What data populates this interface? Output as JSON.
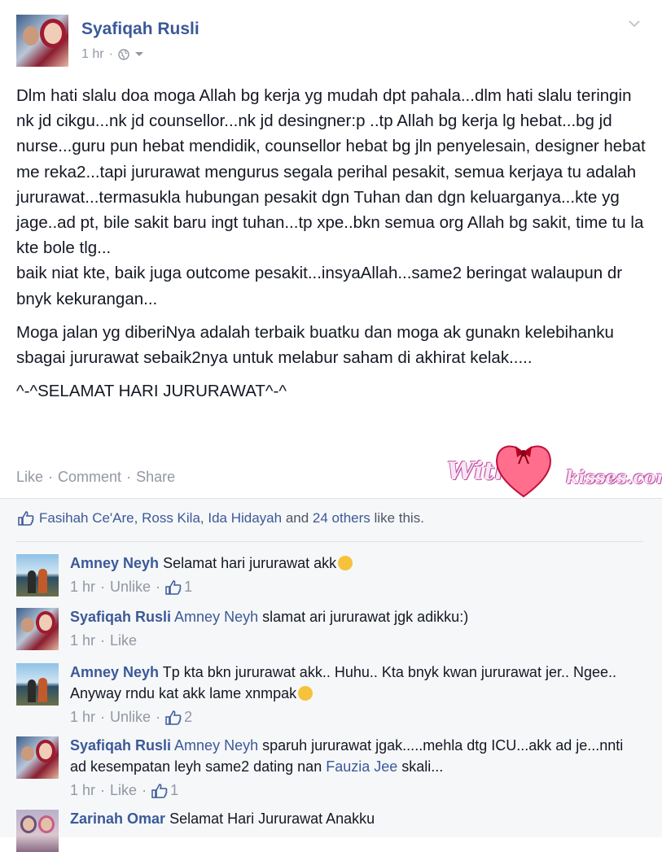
{
  "post": {
    "author": "Syafiqah Rusli",
    "time": "1 hr",
    "paragraphs": [
      "Dlm hati slalu doa moga Allah bg kerja yg mudah dpt pahala...dlm hati slalu teringin nk jd cikgu...nk jd counsellor...nk jd desingner:p ..tp Allah bg kerja lg hebat...bg jd nurse...guru pun hebat mendidik, counsellor hebat bg jln penyelesain, designer hebat me reka2...tapi jururawat mengurus segala perihal pesakit, semua kerjaya tu adalah jururawat...termasukla hubungan pesakit dgn Tuhan dan dgn keluarganya...kte yg jage..ad pt, bile sakit baru ingt tuhan...tp xpe..bkn semua org Allah bg sakit, time tu la kte bole tlg...\nbaik niat kte, baik juga outcome pesakit...insyaAllah...same2 beringat walaupun dr bnyk kekurangan...",
      "Moga jalan yg diberiNya adalah terbaik buatku dan moga ak gunakn kelebihanku sbagai jururawat sebaik2nya untuk melabur saham di akhirat kelak.....",
      "^-^SELAMAT HARI JURURAWAT^-^"
    ],
    "actions": {
      "like": "Like",
      "comment": "Comment",
      "share": "Share",
      "sep": "·"
    }
  },
  "watermark": {
    "with": "With",
    "kisses": "kisses.com"
  },
  "likes": {
    "names": [
      "Fasihah Ce'Are",
      "Ross Kila",
      "Ida Hidayah"
    ],
    "sep1": ", ",
    "and": " and ",
    "others": "24 others",
    "suffix": " like this."
  },
  "comments": [
    {
      "author": "Amney Neyh",
      "mention": "",
      "text": "Selamat hari jururawat akk",
      "emoji": true,
      "time": "1 hr",
      "action": "Unlike",
      "likes": "1"
    },
    {
      "author": "Syafiqah Rusli",
      "mention": "Amney Neyh",
      "text": " slamat ari jururawat jgk adikku:)",
      "emoji": false,
      "time": "1 hr",
      "action": "Like",
      "likes": ""
    },
    {
      "author": "Amney Neyh",
      "mention": "",
      "text": "Tp kta bkn jururawat akk.. Huhu.. Kta bnyk kwan jururawat jer.. Ngee.. Anyway rndu kat akk lame xnmpak",
      "emoji": true,
      "time": "1 hr",
      "action": "Unlike",
      "likes": "2"
    },
    {
      "author": "Syafiqah Rusli",
      "mention": "Amney Neyh",
      "text": " sparuh jururawat jgak.....mehla dtg ICU...akk ad je...nnti ad kesempatan leyh same2 dating nan ",
      "mention2": "Fauzia Jee",
      "text2": " skali...",
      "emoji": false,
      "time": "1 hr",
      "action": "Like",
      "likes": "1"
    },
    {
      "author": "Zarinah Omar",
      "mention": "",
      "text": "Selamat Hari Jururawat Anakku",
      "emoji": false,
      "time": "",
      "action": "",
      "likes": ""
    }
  ],
  "colors": {
    "link": "#3b5998",
    "muted": "#9197a3",
    "text": "#141823",
    "bg_feed": "#f6f7f9"
  }
}
